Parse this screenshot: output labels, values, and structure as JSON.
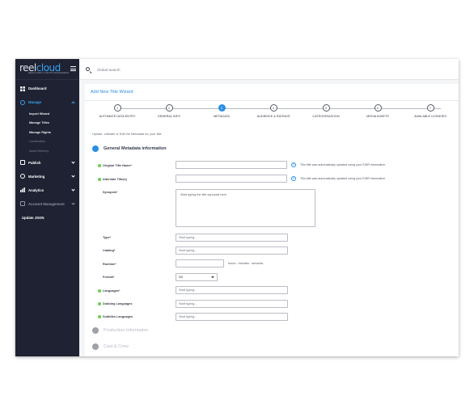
{
  "app": {
    "logo_main": "reel",
    "logo_accent": "cloud",
    "logo_tagline": "MEDIA ASSET & RIGHTS MANAGEMENT"
  },
  "sidebar": {
    "items": [
      {
        "label": "Dashboard",
        "icon": "dashboard-icon"
      },
      {
        "label": "Manage",
        "icon": "manage-icon",
        "expanded": true
      },
      {
        "label": "Publish",
        "icon": "publish-icon"
      },
      {
        "label": "Marketing",
        "icon": "globe-icon"
      },
      {
        "label": "Analytics",
        "icon": "analytics-icon"
      },
      {
        "label": "Account Management",
        "icon": "account-icon"
      },
      {
        "label": "Update JSON"
      }
    ],
    "manage_sub": [
      {
        "label": "Import Wizard"
      },
      {
        "label": "Manage Titles"
      },
      {
        "label": "Manage Rights"
      },
      {
        "label": "Localization"
      },
      {
        "label": "Asset Delivery"
      }
    ]
  },
  "search": {
    "placeholder": "Global Search"
  },
  "page": {
    "title": "Add New Title Wizard",
    "intro": "Update, validate or Edit the Metadata for your title"
  },
  "steps": [
    {
      "num": "1",
      "label": "AUTOMATE DATA ENTRY"
    },
    {
      "num": "2",
      "label": "GENERAL INFO"
    },
    {
      "num": "3",
      "label": "METADATA",
      "active": true
    },
    {
      "num": "4",
      "label": "AUDIENCE & RATINGS"
    },
    {
      "num": "5",
      "label": "CATEGORIZATION"
    },
    {
      "num": "6",
      "label": "MEDIA ASSETS"
    },
    {
      "num": "7",
      "label": "AVAILABLE LICENSES"
    }
  ],
  "sections": {
    "general": "General Metadata information",
    "production": "Production Information",
    "cast": "Cast & Crew"
  },
  "form": {
    "original_title_label": "Original Title Name*",
    "original_title_value": "",
    "alternate_titles_label": "Alternate Title(s)",
    "alternate_titles_value": "",
    "auto_note": "This title was automatically updated using your EIDR information",
    "synopsis_label": "Synopsis*",
    "synopsis_placeholder": "Start typing the title synopsis here",
    "type_label": "Type*",
    "catalog_label": "Catalog*",
    "runtime_label": "Runtime*",
    "runtime_hint": "hours : minutes : seconds",
    "format_label": "Format*",
    "format_value": "SD",
    "languages_label": "Languages*",
    "dubbing_label": "Dubbing Languages",
    "subtitles_label": "Subtitles Languages",
    "typing_placeholder": "Start typing..."
  },
  "colors": {
    "sidebar_bg": "#1f2232",
    "accent": "#2b8ee6",
    "required_dot": "#6fcf5b"
  }
}
